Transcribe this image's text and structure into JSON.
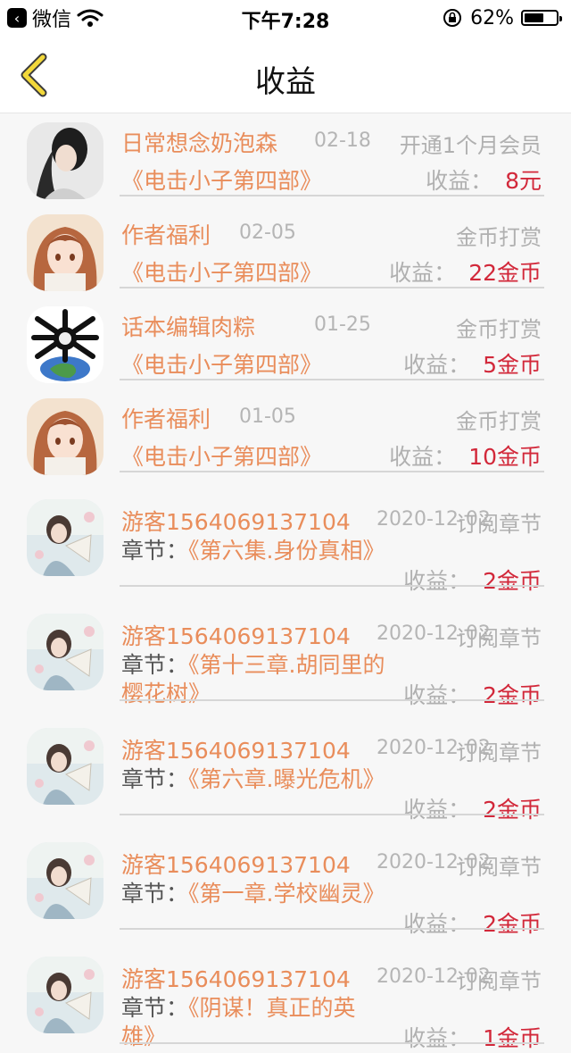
{
  "status": {
    "carrier": "微信",
    "time": "下午7:28",
    "battery": "62%",
    "battery_level": 0.62
  },
  "nav": {
    "title": "收益"
  },
  "list": [
    {
      "name": "日常想念奶泡森",
      "date": "02-18",
      "type": "开通1个月会员",
      "book": "《电击小子第四部》",
      "earn_label": "收益：",
      "amount": "8元",
      "avatar": "girl-bw"
    },
    {
      "name": "作者福利",
      "date": "02-05",
      "type": "金币打赏",
      "book": "《电击小子第四部》",
      "earn_label": "收益：",
      "amount": "22金币",
      "avatar": "anime-girl"
    },
    {
      "name": "话本编辑肉粽",
      "date": "01-25",
      "type": "金币打赏",
      "book": "《电击小子第四部》",
      "earn_label": "收益：",
      "amount": "5金币",
      "avatar": "skull-earth"
    },
    {
      "name": "作者福利",
      "date": "01-05",
      "type": "金币打赏",
      "book": "《电击小子第四部》",
      "earn_label": "收益：",
      "amount": "10金币",
      "avatar": "anime-girl"
    },
    {
      "name": "游客1564069137104",
      "date": "2020-12-02",
      "type": "订阅章节",
      "chapter_label": "章节：",
      "chapter": "《第六集.身份真相》",
      "earn_label": "收益：",
      "amount": "2金币",
      "avatar": "girl-fan"
    },
    {
      "name": "游客1564069137104",
      "date": "2020-12-02",
      "type": "订阅章节",
      "chapter_label": "章节：",
      "chapter": "《第十三章.胡同里的樱花树》",
      "earn_label": "收益：",
      "amount": "2金币",
      "avatar": "girl-fan"
    },
    {
      "name": "游客1564069137104",
      "date": "2020-12-02",
      "type": "订阅章节",
      "chapter_label": "章节：",
      "chapter": "《第六章.曝光危机》",
      "earn_label": "收益：",
      "amount": "2金币",
      "avatar": "girl-fan"
    },
    {
      "name": "游客1564069137104",
      "date": "2020-12-02",
      "type": "订阅章节",
      "chapter_label": "章节：",
      "chapter": "《第一章.学校幽灵》",
      "earn_label": "收益：",
      "amount": "2金币",
      "avatar": "girl-fan"
    },
    {
      "name": "游客1564069137104",
      "date": "2020-12-02",
      "type": "订阅章节",
      "chapter_label": "章节：",
      "chapter": "《阴谋！真正的英雄》",
      "earn_label": "收益：",
      "amount": "1金币",
      "avatar": "girl-fan"
    }
  ]
}
